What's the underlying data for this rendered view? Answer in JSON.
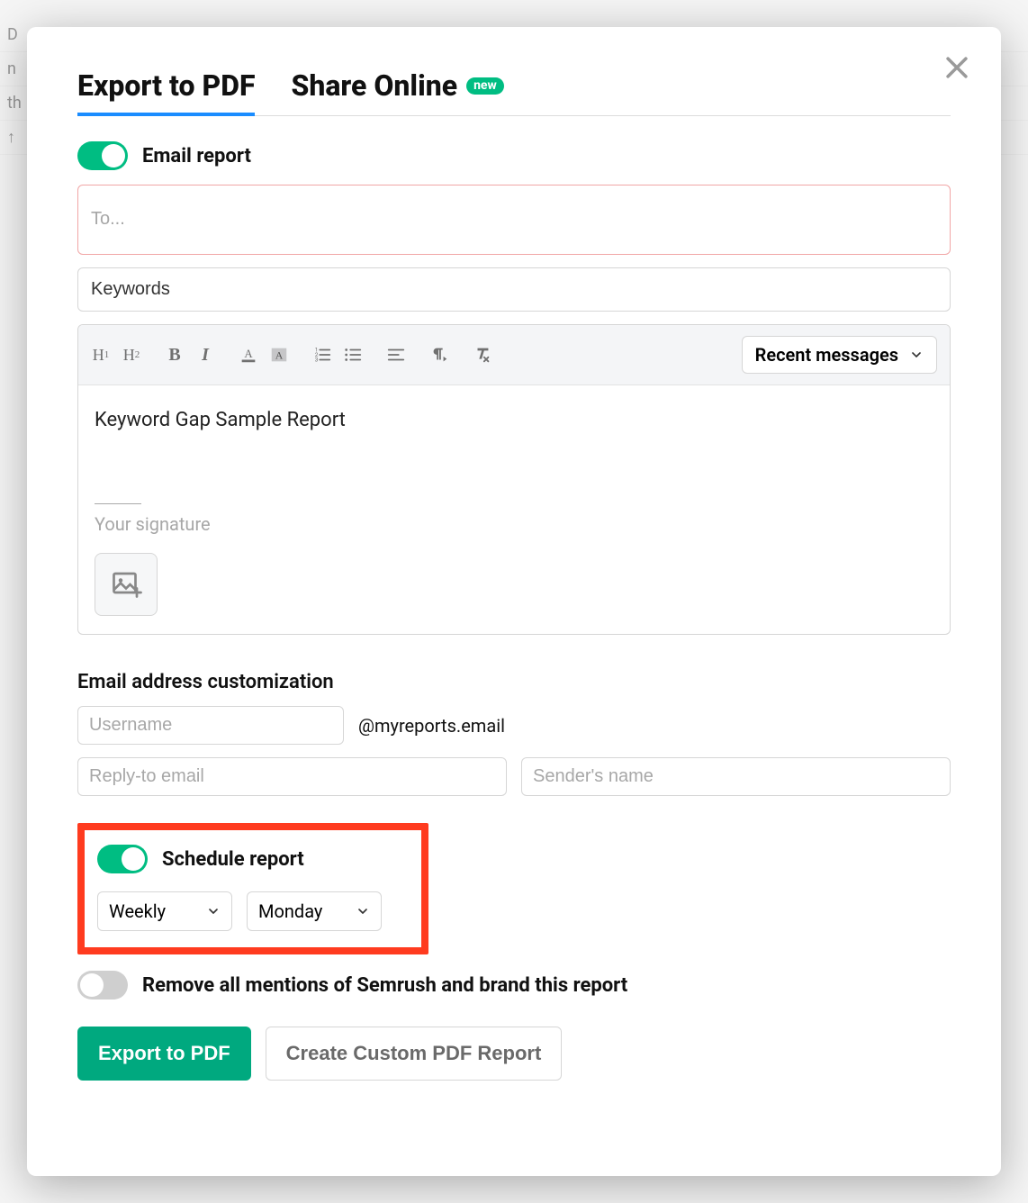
{
  "tabs": {
    "export_pdf": "Export to PDF",
    "share_online": "Share Online",
    "new_badge": "new"
  },
  "email_report": {
    "label": "Email report",
    "to_placeholder": "To...",
    "subject_value": "Keywords"
  },
  "editor": {
    "recent_label": "Recent messages",
    "body_text": "Keyword Gap Sample Report",
    "signature_placeholder": "Your signature",
    "icons": {
      "h1": "H₁",
      "h2": "H₂"
    }
  },
  "email_custom": {
    "section_title": "Email address customization",
    "username_placeholder": "Username",
    "domain": "@myreports.email",
    "reply_to_placeholder": "Reply-to email",
    "sender_placeholder": "Sender's name"
  },
  "schedule": {
    "label": "Schedule report",
    "frequency": "Weekly",
    "day": "Monday"
  },
  "brand": {
    "label": "Remove all mentions of Semrush and brand this report"
  },
  "actions": {
    "export": "Export to PDF",
    "custom": "Create Custom PDF Report"
  }
}
